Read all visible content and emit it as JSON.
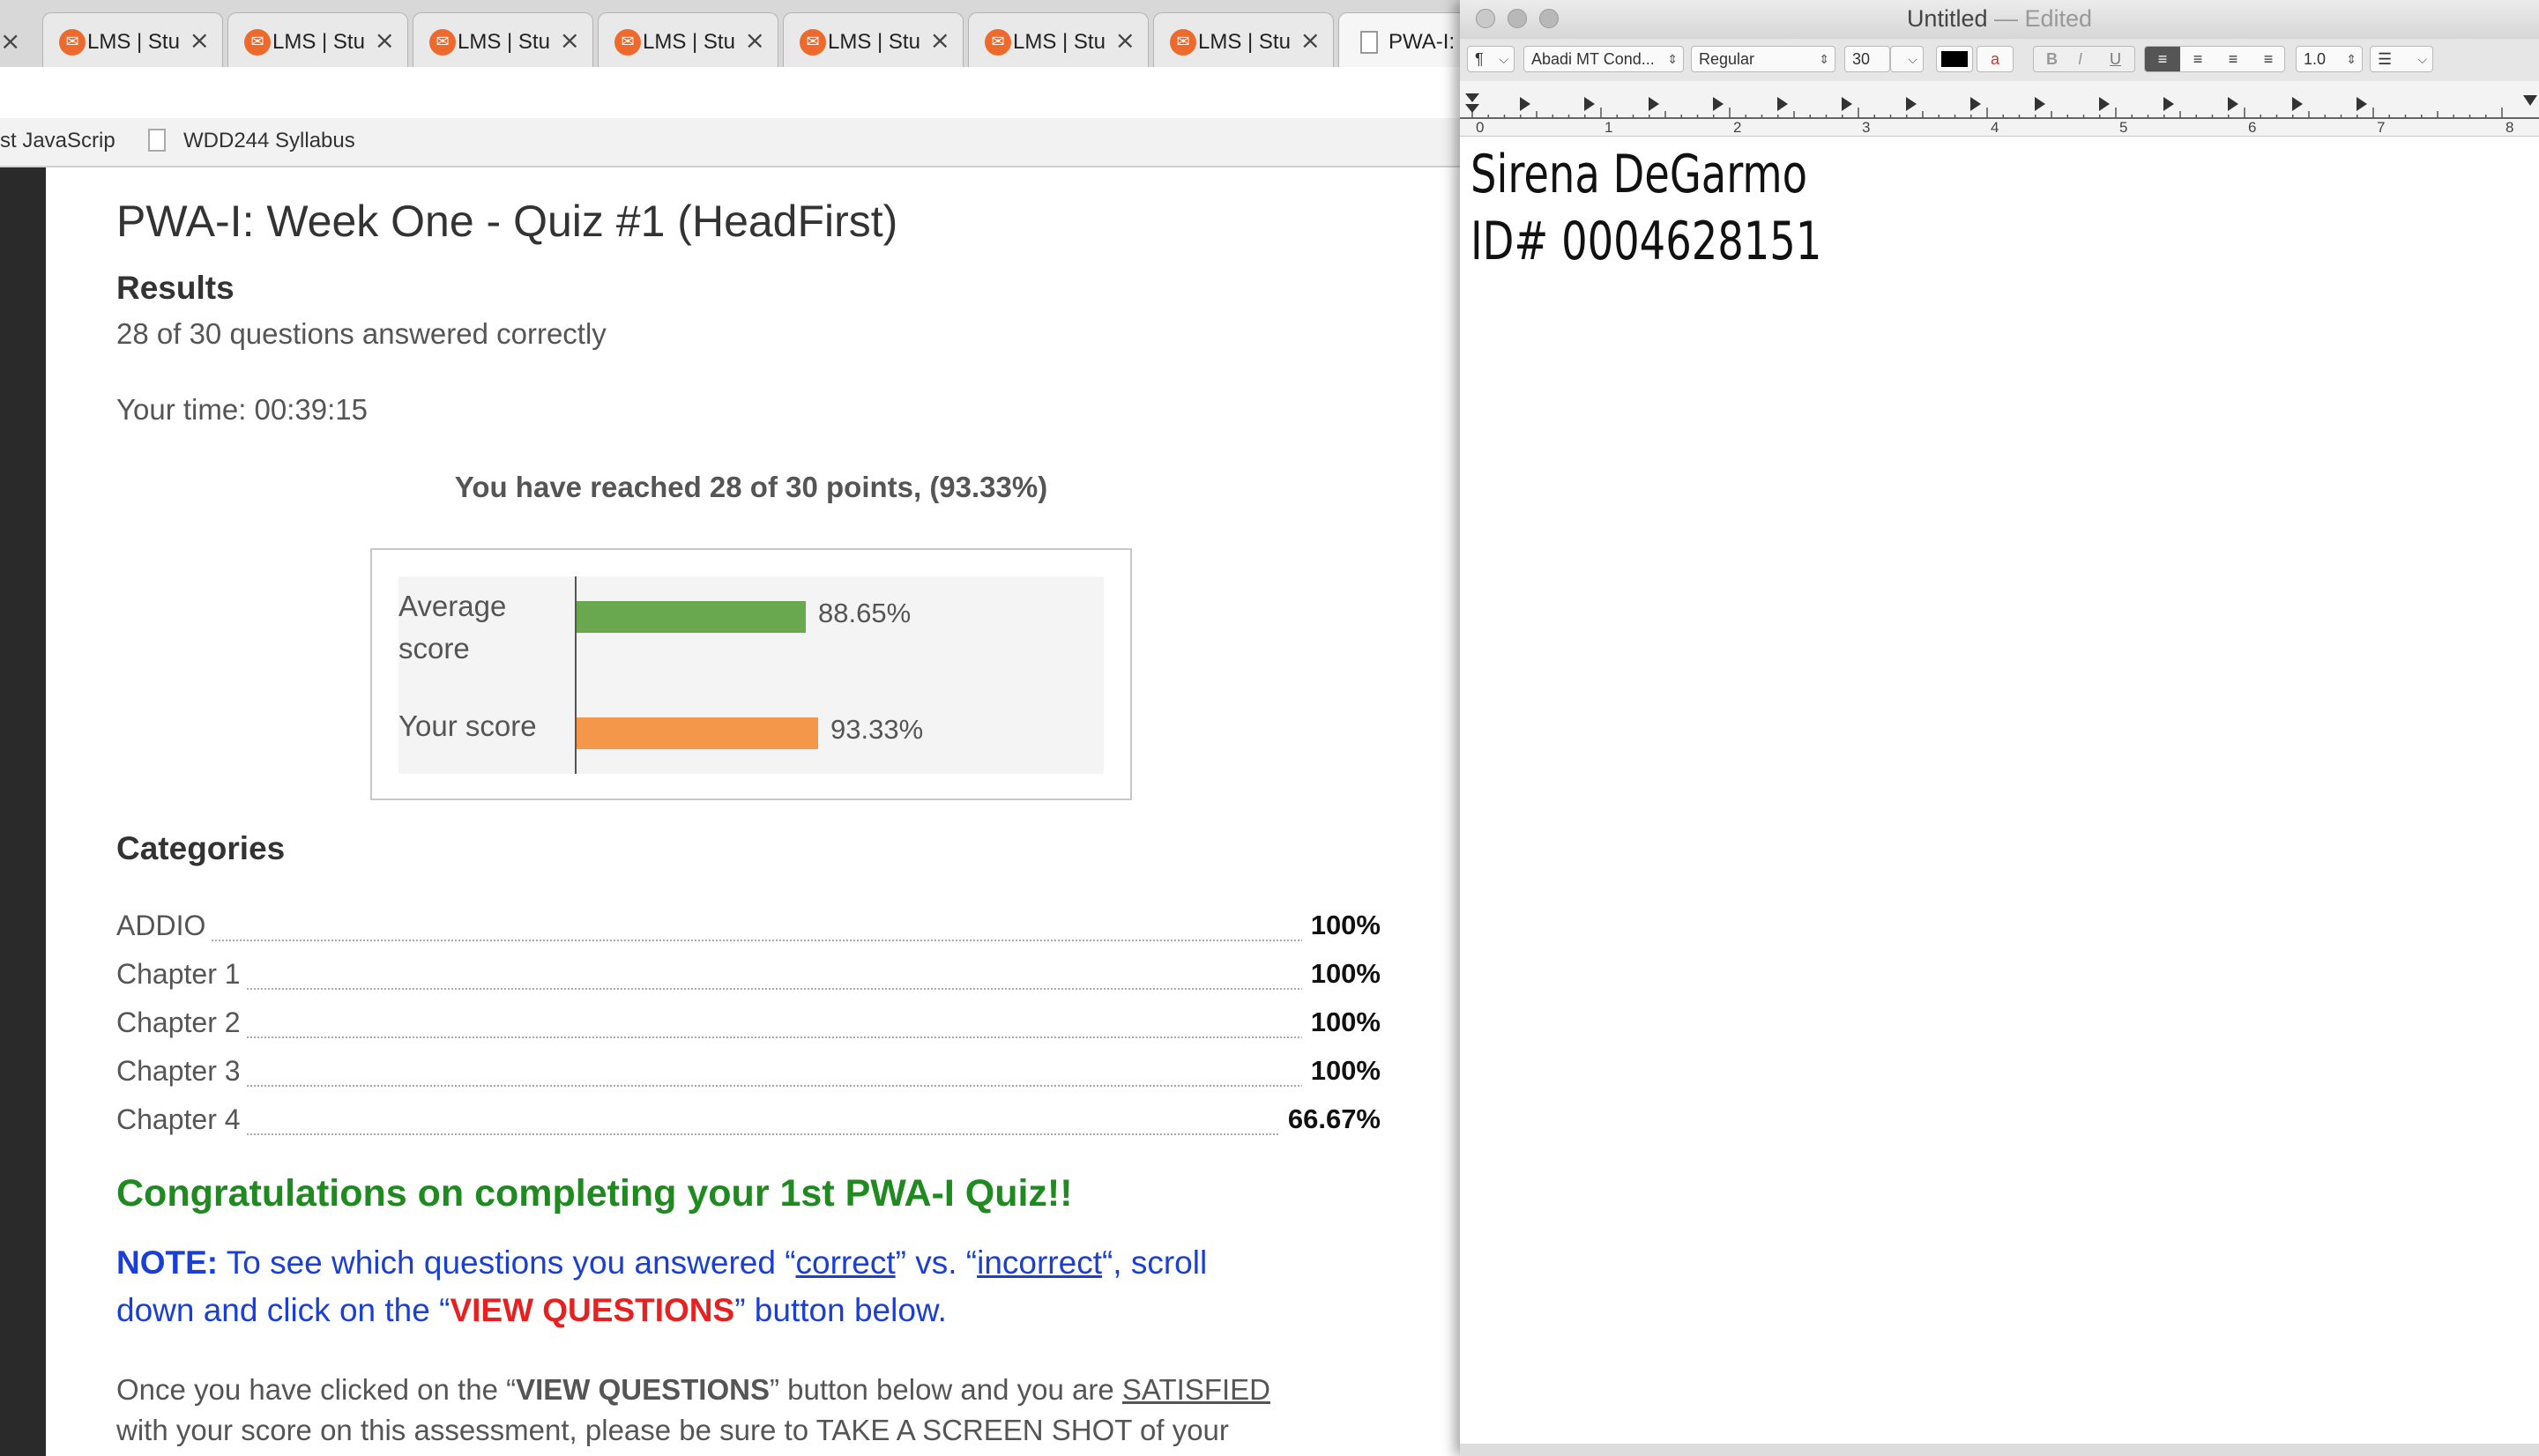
{
  "browser": {
    "tabs": [
      {
        "title": "LMS | Stu",
        "icon": "lms-logo-icon"
      },
      {
        "title": "LMS | Stu",
        "icon": "lms-logo-icon"
      },
      {
        "title": "LMS | Stu",
        "icon": "lms-logo-icon"
      },
      {
        "title": "LMS | Stu",
        "icon": "lms-logo-icon"
      },
      {
        "title": "LMS | Stu",
        "icon": "lms-logo-icon"
      },
      {
        "title": "LMS | Stu",
        "icon": "lms-logo-icon"
      },
      {
        "title": "LMS | Stu",
        "icon": "lms-logo-icon"
      },
      {
        "title": "PWA-I:",
        "icon": "document-icon"
      }
    ],
    "close_glyph": "×",
    "bookmarks": [
      {
        "label": "st JavaScrip"
      },
      {
        "label": "WDD244 Syllabus"
      }
    ]
  },
  "quiz": {
    "title": "PWA-I: Week One - Quiz #1 (HeadFirst)",
    "results_heading": "Results",
    "answered": "28 of 30 questions answered correctly",
    "time": "Your time: 00:39:15",
    "reached": "You have reached 28 of 30 points, (93.33%)",
    "categories_heading": "Categories",
    "categories": [
      {
        "name": "ADDIO",
        "value": "100%"
      },
      {
        "name": "Chapter 1",
        "value": "100%"
      },
      {
        "name": "Chapter 2",
        "value": "100%"
      },
      {
        "name": "Chapter 3",
        "value": "100%"
      },
      {
        "name": "Chapter 4",
        "value": "66.67%"
      }
    ],
    "congrats": "Congratulations on completing your 1st PWA-I Quiz!!",
    "note": {
      "label": "NOTE:",
      "t1": "  To see which questions you answered “",
      "correct": "correct",
      "t2": "” vs. “",
      "incorrect": "incorrect",
      "t3": "“, scroll",
      "t4": "down and click on the “",
      "view": "VIEW QUESTIONS",
      "t5": "” button below."
    },
    "para": {
      "p1": "Once you have clicked on the “",
      "view": "VIEW QUESTIONS",
      "p2": "” button below and you are ",
      "satisfied": "SATISFIED",
      "line2": "with your score on this assessment, please be sure to TAKE A SCREEN SHOT of your"
    }
  },
  "chart_data": {
    "type": "bar",
    "orientation": "horizontal",
    "categories": [
      "Average score",
      "Your score"
    ],
    "values": [
      88.65,
      93.33
    ],
    "labels": [
      "88.65%",
      "93.33%"
    ],
    "colors": [
      "#6aa84f",
      "#f4974b"
    ],
    "xlim": [
      0,
      100
    ]
  },
  "textedit": {
    "title": "Untitled",
    "title_sep": " — ",
    "status": "Edited",
    "toolbar": {
      "paragraph": "¶",
      "font": "Abadi MT Cond...",
      "style": "Regular",
      "size": "30",
      "spacing": "1.0",
      "bold": "B",
      "italic": "I",
      "underline": "U"
    },
    "ruler_numbers": [
      "0",
      "1",
      "2",
      "3",
      "4",
      "5",
      "6",
      "7",
      "8"
    ],
    "lines": [
      "Sirena DeGarmo",
      "ID# 0004628151"
    ]
  }
}
